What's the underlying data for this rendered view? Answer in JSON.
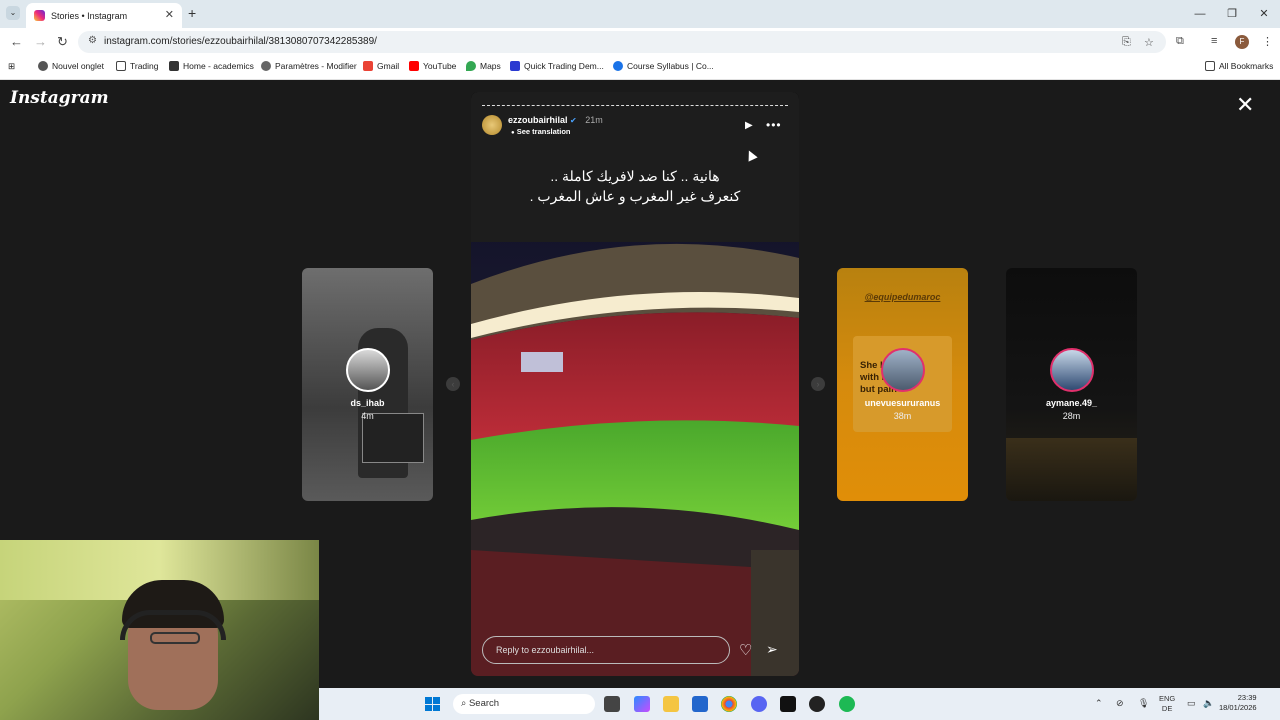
{
  "browser": {
    "tab_title": "Stories • Instagram",
    "url": "instagram.com/stories/ezzoubairhilal/3813080707342285389/",
    "bookmarks": [
      "Nouvel onglet",
      "Trading",
      "Home - academics",
      "Paramètres - Modifier",
      "Gmail",
      "YouTube",
      "Maps",
      "Quick Trading Dem...",
      "Course Syllabus | Co..."
    ],
    "all_bookmarks": "All Bookmarks",
    "profile_initial": "F"
  },
  "instagram": {
    "logo": "Instagram",
    "story": {
      "username": "ezzoubairhilal",
      "time": "21m",
      "see_translation": "See translation",
      "text_line1": "هانية .. كنا ضد لافريك كاملة ..",
      "text_line2": "كنعرف غير المغرب و عاش المغرب .",
      "reply_placeholder": "Reply to ezzoubairhilal..."
    },
    "side_stories": [
      {
        "name": "ds_ihab",
        "time": "4m"
      },
      {
        "name": "unevuesururanus",
        "time": "38m",
        "card_label": "@equipedumaroc",
        "card_text": "She heard with nothin' but pain"
      },
      {
        "name": "aymane.49_",
        "time": "28m"
      }
    ]
  },
  "taskbar": {
    "search": "Search",
    "lang_line1": "ENG",
    "lang_line2": "DE",
    "time": "23:39",
    "date": "18/01/2026"
  }
}
